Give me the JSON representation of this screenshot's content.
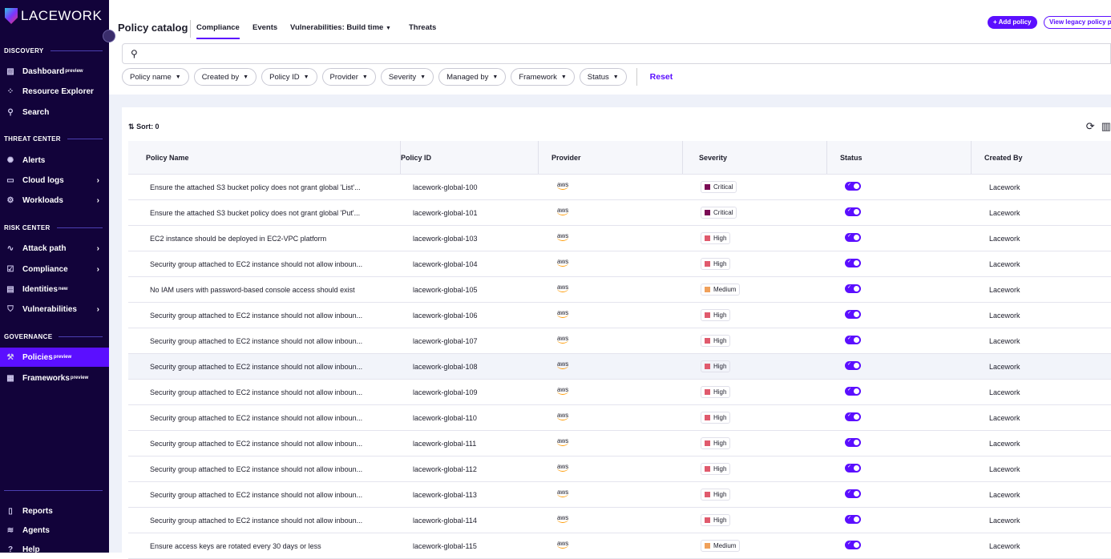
{
  "brand": "LACEWORK",
  "sidebar": {
    "sections": [
      {
        "label": "DISCOVERY"
      },
      {
        "label": "THREAT CENTER"
      },
      {
        "label": "RISK CENTER"
      },
      {
        "label": "GOVERNANCE"
      }
    ],
    "items": [
      {
        "label": "Dashboard",
        "badge": "preview",
        "icon": "dashboard-icon",
        "glyph": "▨"
      },
      {
        "label": "Resource Explorer",
        "icon": "resource-explorer-icon",
        "glyph": "⁘"
      },
      {
        "label": "Search",
        "icon": "search-icon",
        "glyph": "⚲"
      },
      {
        "label": "Alerts",
        "icon": "alert-icon",
        "glyph": "✺"
      },
      {
        "label": "Cloud logs",
        "icon": "cloud-logs-icon",
        "glyph": "▭",
        "chevron": true
      },
      {
        "label": "Workloads",
        "icon": "workloads-icon",
        "glyph": "⚙",
        "chevron": true
      },
      {
        "label": "Attack path",
        "icon": "attack-path-icon",
        "glyph": "∿",
        "chevron": true
      },
      {
        "label": "Compliance",
        "icon": "compliance-icon",
        "glyph": "☑",
        "chevron": true
      },
      {
        "label": "Identities",
        "badge": "new",
        "icon": "identities-icon",
        "glyph": "▤"
      },
      {
        "label": "Vulnerabilities",
        "icon": "shield-icon",
        "glyph": "⛉",
        "chevron": true
      },
      {
        "label": "Policies",
        "badge": "preview",
        "icon": "gavel-icon",
        "glyph": "⚒",
        "active": true
      },
      {
        "label": "Frameworks",
        "badge": "preview",
        "icon": "clipboard-icon",
        "glyph": "▦"
      },
      {
        "label": "Reports",
        "icon": "reports-icon",
        "glyph": "▯"
      },
      {
        "label": "Agents",
        "icon": "agents-icon",
        "glyph": "≋"
      },
      {
        "label": "Help",
        "icon": "help-icon",
        "glyph": "?"
      }
    ]
  },
  "header": {
    "title": "Policy catalog",
    "tabs": [
      "Compliance",
      "Events",
      "Vulnerabilities: Build time",
      "Threats"
    ],
    "add_policy": "+ Add policy",
    "legacy": "View legacy policy p"
  },
  "filters": [
    "Policy name",
    "Created by",
    "Policy ID",
    "Provider",
    "Severity",
    "Managed by",
    "Framework",
    "Status"
  ],
  "reset": "Reset",
  "sort": "Sort: 0",
  "columns": [
    "Policy Name",
    "Policy ID",
    "Provider",
    "Severity",
    "Status",
    "Created By"
  ],
  "severity_colors": {
    "Critical": "#7a0b55",
    "High": "#e05a6d",
    "Medium": "#f0a05a"
  },
  "rows": [
    {
      "name": "Ensure the attached S3 bucket policy does not grant global 'List'...",
      "id": "lacework-global-100",
      "provider": "aws",
      "severity": "Critical",
      "status": true,
      "created_by": "Lacework"
    },
    {
      "name": "Ensure the attached S3 bucket policy does not grant global 'Put'...",
      "id": "lacework-global-101",
      "provider": "aws",
      "severity": "Critical",
      "status": true,
      "created_by": "Lacework"
    },
    {
      "name": "EC2 instance should be deployed in EC2-VPC platform",
      "id": "lacework-global-103",
      "provider": "aws",
      "severity": "High",
      "status": true,
      "created_by": "Lacework"
    },
    {
      "name": "Security group attached to EC2 instance should not allow inboun...",
      "id": "lacework-global-104",
      "provider": "aws",
      "severity": "High",
      "status": true,
      "created_by": "Lacework"
    },
    {
      "name": "No IAM users with password-based console access should exist",
      "id": "lacework-global-105",
      "provider": "aws",
      "severity": "Medium",
      "status": true,
      "created_by": "Lacework"
    },
    {
      "name": "Security group attached to EC2 instance should not allow inboun...",
      "id": "lacework-global-106",
      "provider": "aws",
      "severity": "High",
      "status": true,
      "created_by": "Lacework"
    },
    {
      "name": "Security group attached to EC2 instance should not allow inboun...",
      "id": "lacework-global-107",
      "provider": "aws",
      "severity": "High",
      "status": true,
      "created_by": "Lacework"
    },
    {
      "name": "Security group attached to EC2 instance should not allow inboun...",
      "id": "lacework-global-108",
      "provider": "aws",
      "severity": "High",
      "status": true,
      "created_by": "Lacework"
    },
    {
      "name": "Security group attached to EC2 instance should not allow inboun...",
      "id": "lacework-global-109",
      "provider": "aws",
      "severity": "High",
      "status": true,
      "created_by": "Lacework"
    },
    {
      "name": "Security group attached to EC2 instance should not allow inboun...",
      "id": "lacework-global-110",
      "provider": "aws",
      "severity": "High",
      "status": true,
      "created_by": "Lacework"
    },
    {
      "name": "Security group attached to EC2 instance should not allow inboun...",
      "id": "lacework-global-111",
      "provider": "aws",
      "severity": "High",
      "status": true,
      "created_by": "Lacework"
    },
    {
      "name": "Security group attached to EC2 instance should not allow inboun...",
      "id": "lacework-global-112",
      "provider": "aws",
      "severity": "High",
      "status": true,
      "created_by": "Lacework"
    },
    {
      "name": "Security group attached to EC2 instance should not allow inboun...",
      "id": "lacework-global-113",
      "provider": "aws",
      "severity": "High",
      "status": true,
      "created_by": "Lacework"
    },
    {
      "name": "Security group attached to EC2 instance should not allow inboun...",
      "id": "lacework-global-114",
      "provider": "aws",
      "severity": "High",
      "status": true,
      "created_by": "Lacework"
    },
    {
      "name": "Ensure access keys are rotated every 30 days or less",
      "id": "lacework-global-115",
      "provider": "aws",
      "severity": "Medium",
      "status": true,
      "created_by": "Lacework"
    }
  ]
}
